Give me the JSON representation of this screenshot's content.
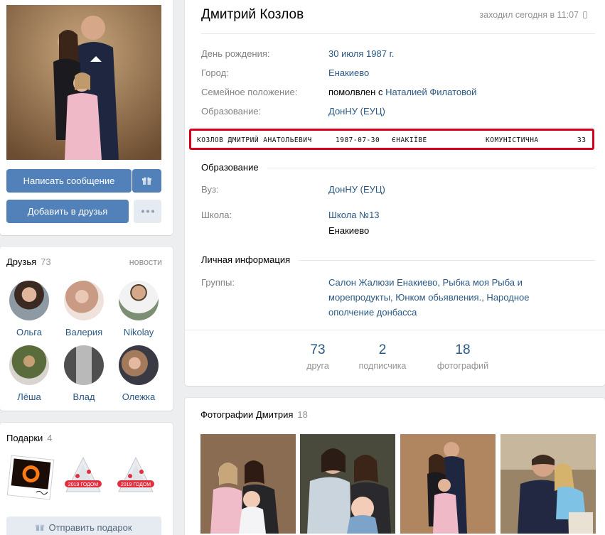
{
  "profile": {
    "name": "Дмитрий Козлов",
    "online_status": "заходил сегодня в 11:07",
    "info": [
      {
        "label": "День рождения:",
        "value": "30 июля 1987 г."
      },
      {
        "label": "Город:",
        "value": "Енакиево"
      },
      {
        "label": "Семейное положение:",
        "value_prefix": "помолвлен с",
        "value": "Наталией Филатовой"
      },
      {
        "label": "Образование:",
        "value": "ДонНУ (ЕУЦ)"
      }
    ],
    "highlight_record": {
      "full_name": "КОЗЛОВ ДМИТРИЙ АНАТОЛЬЕВИЧ",
      "birth_date": "1987-07-30",
      "city": "ЄНАКІЇВЕ",
      "street": "КОМУНІСТИЧНА",
      "number": "33",
      "border_color": "#d6001c"
    },
    "education_section": {
      "title": "Образование",
      "university_label": "Вуз:",
      "university": "ДонНУ (ЕУЦ)",
      "school_label": "Школа:",
      "school": "Школа №13",
      "school_city": "Енакиево"
    },
    "personal_section": {
      "title": "Личная информация",
      "groups_label": "Группы:",
      "groups_line1": "Салон Жалюзи Енакиево, Рыбка моя Рыба и",
      "groups_line2": "морепродукты, Юнком обьявления., Народное",
      "groups_line3": "ополчение донбасса"
    },
    "counters": [
      {
        "num": "73",
        "label": "друга"
      },
      {
        "num": "2",
        "label": "подписчика"
      },
      {
        "num": "18",
        "label": "фотографий"
      }
    ]
  },
  "actions": {
    "message_button": "Написать сообщение",
    "add_friend_button": "Добавить в друзья",
    "gift_icon": "gift-icon",
    "more_icon": "more-dots-icon"
  },
  "friends": {
    "title": "Друзья",
    "count": "73",
    "link": "новости",
    "items": [
      {
        "name": "Ольга"
      },
      {
        "name": "Валерия"
      },
      {
        "name": "Nikolay"
      },
      {
        "name": "Лёша"
      },
      {
        "name": "Влад"
      },
      {
        "name": "Олежка"
      }
    ]
  },
  "gifts": {
    "title": "Подарки",
    "count": "4",
    "send_button": "Отправить подарок",
    "postcard_text": "2019 ГОДОМ"
  },
  "photos": {
    "title": "Фотографии Дмитрия",
    "count": "18"
  },
  "colors": {
    "accent": "#5181b8",
    "link": "#2a5885",
    "muted": "#939393",
    "background": "#edeef0"
  }
}
